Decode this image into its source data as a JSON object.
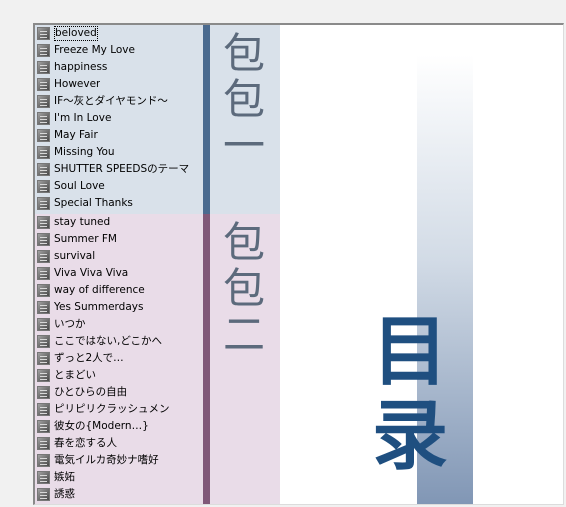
{
  "sections": [
    {
      "title": [
        "包",
        "包",
        "一"
      ],
      "items": [
        "beloved",
        "Freeze My Love",
        "happiness",
        "However",
        "IF～灰とダイヤモンド～",
        "I'm In Love",
        "May Fair",
        "Missing You",
        "SHUTTER SPEEDSのテーマ",
        "Soul Love",
        "Special Thanks"
      ]
    },
    {
      "title": [
        "包",
        "包",
        "二"
      ],
      "items": [
        "stay tuned",
        "Summer FM",
        "survival",
        "Viva Viva Viva",
        "way of difference",
        "Yes Summerdays",
        "いつか",
        "ここではない,どこかへ",
        "ずっと2人で…",
        "とまどい",
        "ひとひらの自由",
        "ピリピリクラッシュメン",
        "彼女の{Modern…}",
        "春を恋する人",
        "電気イルカ奇妙ナ嗜好",
        "嫉妬",
        "誘惑"
      ]
    }
  ],
  "toc": [
    "目",
    "录"
  ],
  "colors": {
    "section1_bg": "#d9e1ea",
    "section1_bar": "#4a6a8f",
    "section2_bg": "#e9dce8",
    "section2_bar": "#805878",
    "toc_text": "#1f4f80"
  },
  "icons": {
    "item": "file-icon"
  }
}
